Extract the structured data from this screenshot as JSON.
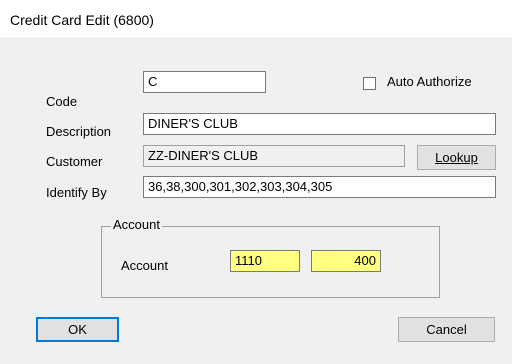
{
  "window": {
    "title": "Credit Card Edit (6800)"
  },
  "form": {
    "code_label": "Code",
    "code_value": "C",
    "auto_authorize_label": "Auto Authorize",
    "auto_authorize_checked": false,
    "description_label": "Description",
    "description_value": "DINER'S CLUB",
    "customer_label": "Customer",
    "customer_value": "ZZ-DINER'S CLUB",
    "lookup_label": "Lookup",
    "identify_label": "Identify By",
    "identify_value": "36,38,300,301,302,303,304,305"
  },
  "account_group": {
    "title": "Account",
    "label": "Account",
    "value1": "1110",
    "value2": "400",
    "highlight_color": "#ffff80"
  },
  "buttons": {
    "ok": "OK",
    "cancel": "Cancel"
  }
}
